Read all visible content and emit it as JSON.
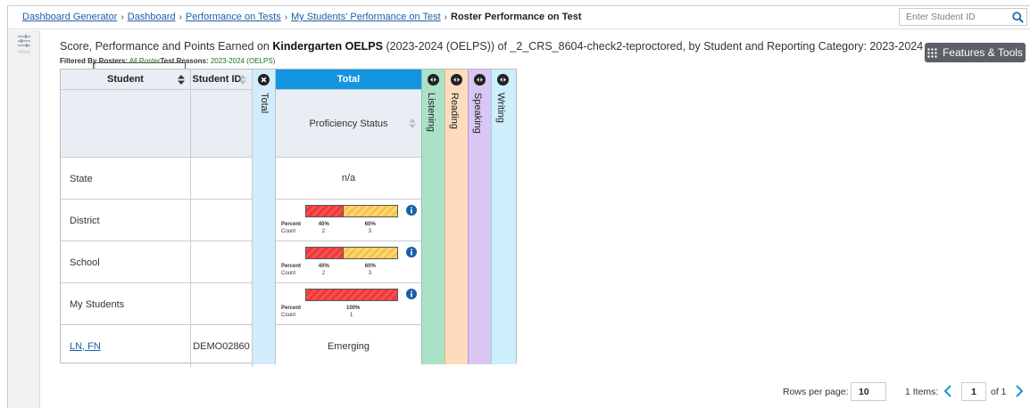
{
  "breadcrumb": {
    "items": [
      "Dashboard Generator",
      "Dashboard",
      "Performance on Tests",
      "My Students' Performance on Test"
    ],
    "current": "Roster Performance on Test"
  },
  "search": {
    "placeholder": "Enter Student ID",
    "value": ""
  },
  "siderail": {
    "filter_label": "Filters"
  },
  "title": {
    "prefix": "Score, Performance and Points Earned on ",
    "bold": "Kindergarten OELPS",
    "suffix": " (2023-2024 (OELPS)) of _2_CRS_8604-check2-teproctored, by Student and Reporting Category: 2023-2024"
  },
  "filters": {
    "label": "Filtered By",
    "rosters_key": "Rosters:",
    "rosters_val": "All Roster",
    "reasons_key": "Test Reasons:",
    "reasons_val": "2023-2024 (OELPS)"
  },
  "features_button": "Features & Tools",
  "table": {
    "headers": {
      "student": "Student",
      "student_id": "Student ID",
      "total_collapsed": "Total",
      "total": "Total",
      "proficiency": "Proficiency Status"
    },
    "categories": [
      "Listening",
      "Reading",
      "Speaking",
      "Writing"
    ],
    "rows": [
      {
        "name": "State",
        "student_id": "",
        "status": "n/a"
      },
      {
        "name": "District",
        "student_id": "",
        "bar": {
          "percent_label": "Percent",
          "count_label": "Count",
          "segments": [
            {
              "percent": 40,
              "percent_text": "40%",
              "count": "2"
            },
            {
              "percent": 60,
              "percent_text": "60%",
              "count": "3"
            }
          ]
        }
      },
      {
        "name": "School",
        "student_id": "",
        "bar": {
          "percent_label": "Percent",
          "count_label": "Count",
          "segments": [
            {
              "percent": 40,
              "percent_text": "40%",
              "count": "2"
            },
            {
              "percent": 60,
              "percent_text": "60%",
              "count": "3"
            }
          ]
        }
      },
      {
        "name": "My Students",
        "student_id": "",
        "bar": {
          "percent_label": "Percent",
          "count_label": "Count",
          "segments": [
            {
              "percent": 100,
              "percent_text": "100%",
              "count": "1"
            }
          ]
        }
      },
      {
        "name": "LN, FN",
        "student_id": "DEMO02860",
        "status": "Emerging",
        "link": true
      }
    ]
  },
  "colors": {
    "total_header": "#1495e1",
    "listening": "#abe2c7",
    "reading": "#fddcbd",
    "speaking": "#d9c6f2",
    "writing": "#cdeefb",
    "below": "#ff4d4d",
    "near": "#ffd66b"
  },
  "pagination": {
    "rows_per_page_label": "Rows per page:",
    "rows_per_page": "10",
    "items": "1 Items:",
    "page": "1",
    "of": "of 1"
  }
}
